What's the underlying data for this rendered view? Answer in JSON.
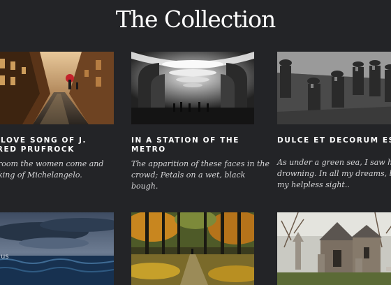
{
  "page": {
    "title": "The Collection"
  },
  "cards_row1": [
    {
      "image_alt": "Rainy cobblestone street with red umbrella",
      "title_lines": [
        "E LOVE SONG OF J.",
        "FRED PRUFROCK"
      ],
      "desc_lines": [
        "e room the women come and",
        "alking of Michelangelo."
      ]
    },
    {
      "image_alt": "Metro station hall in black and white",
      "title_lines": [
        "IN A STATION OF THE",
        "METRO"
      ],
      "desc_lines": [
        "The apparition of these faces in the",
        "crowd; Petals on a wet, black",
        "bough."
      ]
    },
    {
      "image_alt": "Soldiers in helmets in a trench",
      "title_lines": [
        "DULCE ET DECORUM ES"
      ],
      "desc_lines": [
        "As under a green sea, I saw him",
        "drowning. In all my dreams, bef",
        "my helpless sight.."
      ]
    }
  ],
  "cards_row2": [
    {
      "image_alt": "Stormy sea under dark clouds",
      "caption": "us"
    },
    {
      "image_alt": "Path through an autumn forest"
    },
    {
      "image_alt": "Stone church with graveyard"
    }
  ],
  "colors": {
    "background": "#232427",
    "title_text": "#ffffff",
    "body_text": "#d6d6d8"
  }
}
